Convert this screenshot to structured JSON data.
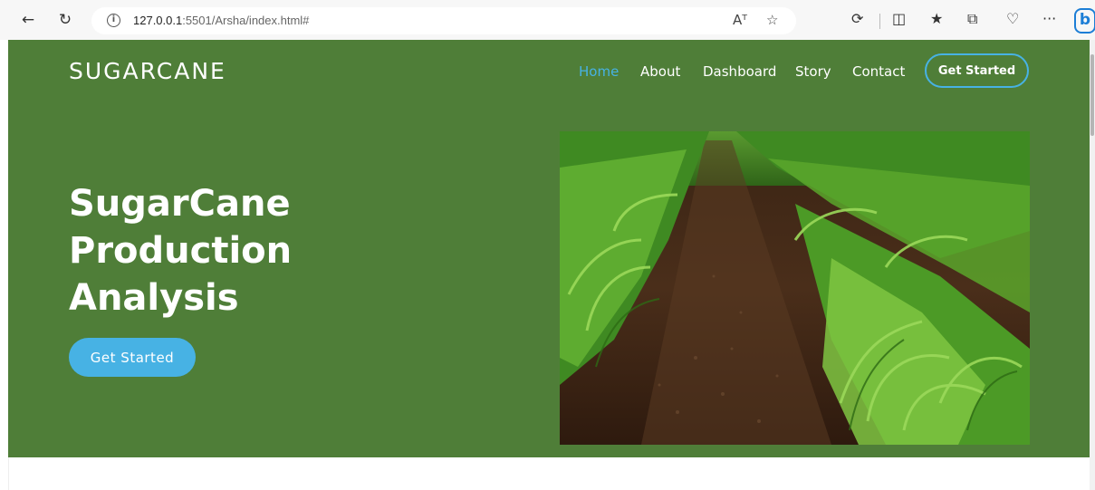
{
  "browser": {
    "back_icon": "back-arrow-icon",
    "reload_icon": "reload-icon",
    "url_host": "127.0.0.1",
    "url_rest": ":5501/Arsha/index.html#",
    "icons": [
      "read-aloud-icon",
      "favorite-star-icon",
      "extensions-icon",
      "split-screen-icon",
      "favorites-icon",
      "collections-icon",
      "performance-icon",
      "more-icon",
      "bing-icon"
    ],
    "read_aloud_glyph": "Aᵀ",
    "more_glyph": "···",
    "bing_glyph": "b"
  },
  "header": {
    "logo": "SUGARCANE",
    "nav": [
      {
        "label": "Home",
        "active": true
      },
      {
        "label": "About",
        "active": false
      },
      {
        "label": "Dashboard",
        "active": false
      },
      {
        "label": "Story",
        "active": false
      },
      {
        "label": "Contact",
        "active": false
      }
    ],
    "cta_label": "Get Started"
  },
  "hero": {
    "title_line1": "SugarCane Production",
    "title_line2": "Analysis",
    "cta_label": "Get Started",
    "image_subject": "crop-field-rows-photo"
  },
  "colors": {
    "hero_bg": "#4f7e38",
    "accent": "#47b2e4",
    "text": "#ffffff"
  }
}
